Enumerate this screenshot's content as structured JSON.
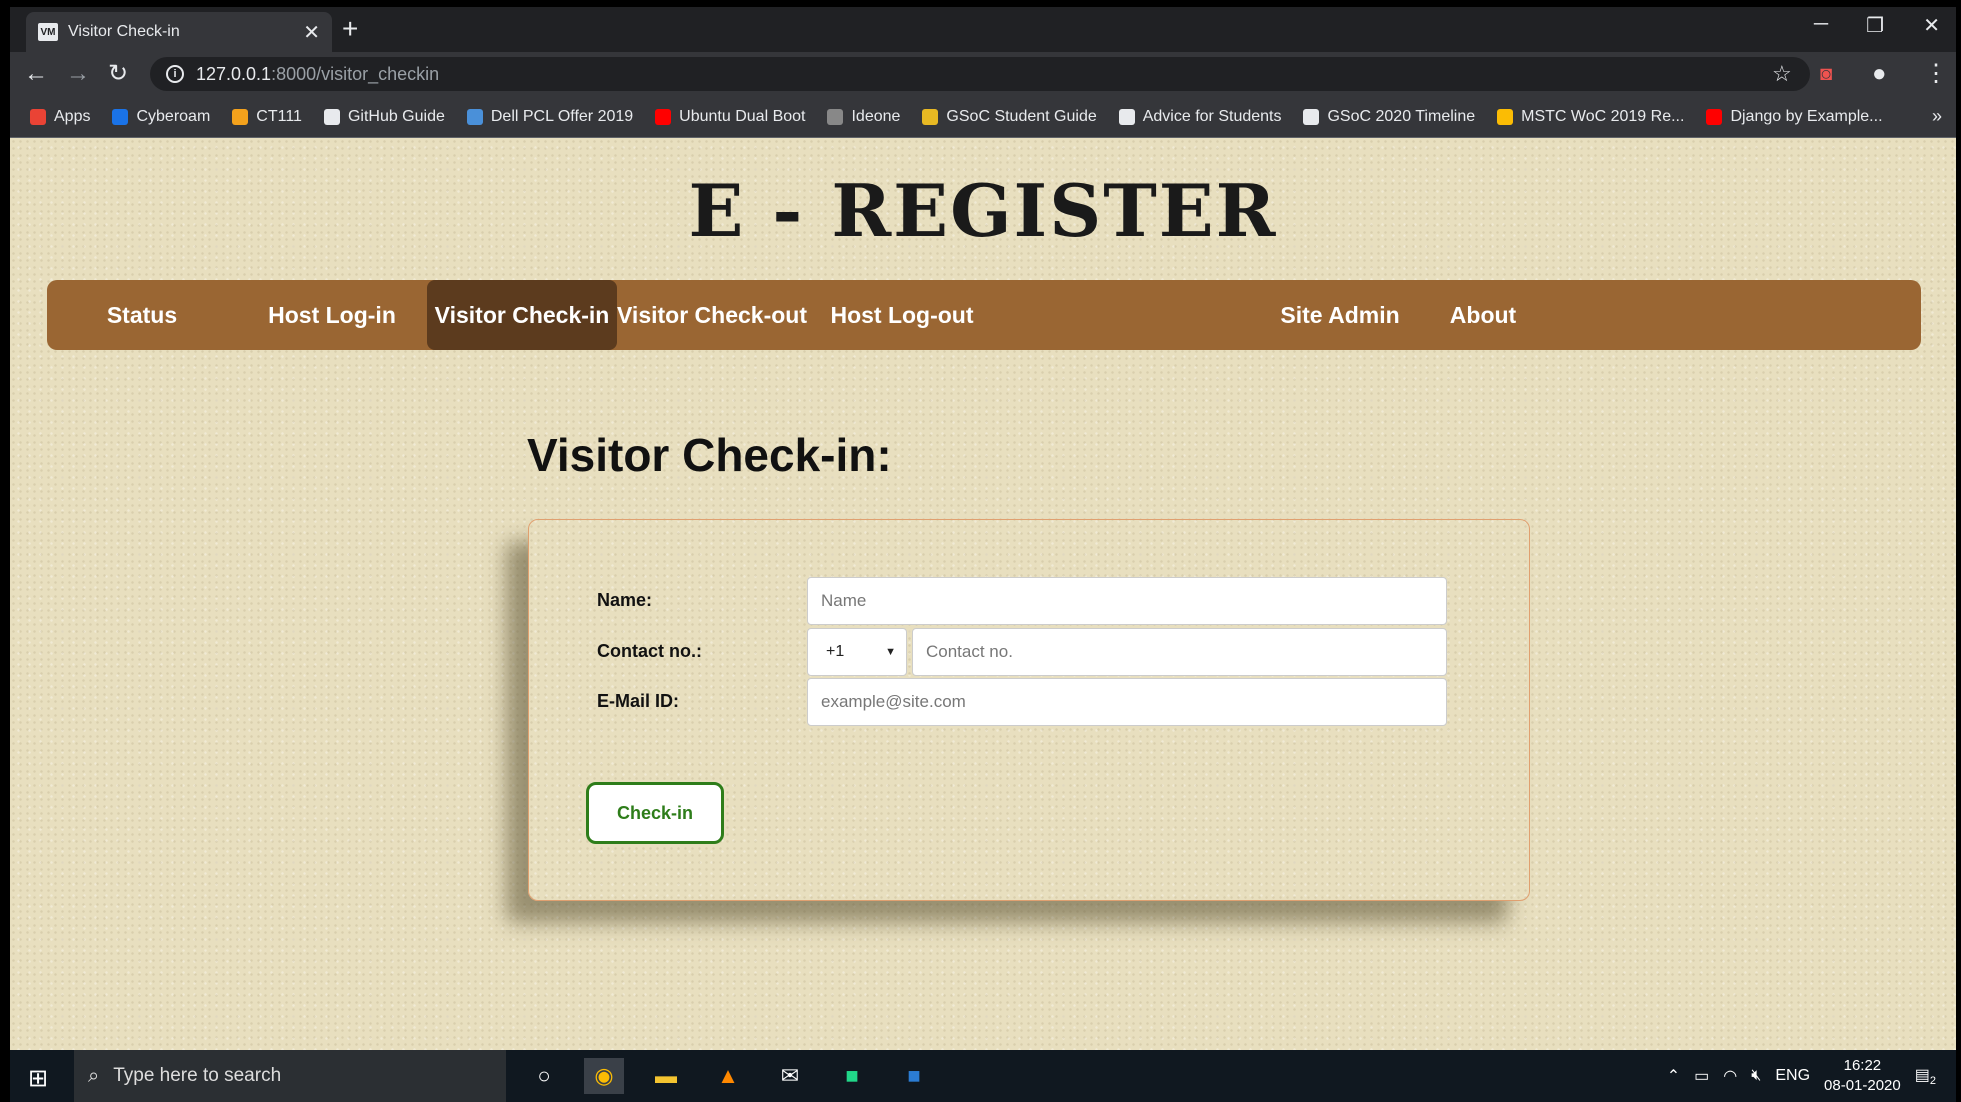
{
  "browser": {
    "tab_title": "Visitor Check-in",
    "tab_favicon": "VM",
    "url_host": "127.0.0.1",
    "url_path": ":8000/visitor_checkin",
    "bookmarks": [
      {
        "label": "Apps",
        "icon": "apps-grid-icon",
        "color": "#ea4335"
      },
      {
        "label": "Cyberoam",
        "icon": "cyberoam-icon",
        "color": "#1a73e8"
      },
      {
        "label": "CT111",
        "icon": "ct111-icon",
        "color": "#f4a21c"
      },
      {
        "label": "GitHub Guide",
        "icon": "github-icon",
        "color": "#e8eaed"
      },
      {
        "label": "Dell PCL Offer 2019",
        "icon": "dell-icon",
        "color": "#4a90d9"
      },
      {
        "label": "Ubuntu Dual Boot",
        "icon": "youtube-icon",
        "color": "#ff0000"
      },
      {
        "label": "Ideone",
        "icon": "ideone-icon",
        "color": "#888888"
      },
      {
        "label": "GSoC Student Guide",
        "icon": "gsoc-icon",
        "color": "#e8b923"
      },
      {
        "label": "Advice for Students",
        "icon": "code-icon",
        "color": "#e8eaed"
      },
      {
        "label": "GSoC 2020 Timeline",
        "icon": "code-icon",
        "color": "#e8eaed"
      },
      {
        "label": "MSTC WoC 2019 Re...",
        "icon": "drive-icon",
        "color": "#fbbc04"
      },
      {
        "label": "Django by Example...",
        "icon": "youtube-icon",
        "color": "#ff0000"
      }
    ]
  },
  "site": {
    "logo": "E - REGISTER",
    "menu": [
      {
        "label": "Status",
        "active": false
      },
      {
        "label": "Host Log-in",
        "active": false
      },
      {
        "label": "Visitor Check-in",
        "active": true
      },
      {
        "label": "Visitor Check-out",
        "active": false
      },
      {
        "label": "Host Log-out",
        "active": false
      },
      {
        "label": "Site Admin",
        "active": false
      },
      {
        "label": "About",
        "active": false
      }
    ]
  },
  "form": {
    "heading": "Visitor Check-in:",
    "name_label": "Name:",
    "name_placeholder": "Name",
    "contact_label": "Contact no.:",
    "country_code": "+1",
    "contact_placeholder": "Contact no.",
    "email_label": "E-Mail ID:",
    "email_placeholder": "example@site.com",
    "submit_label": "Check-in"
  },
  "taskbar": {
    "search_placeholder": "Type here to search",
    "lang": "ENG",
    "time": "16:22",
    "date": "08-01-2020",
    "notifications": "2"
  },
  "colors": {
    "menu_bg": "#9a6633",
    "menu_active": "#5c3b1e",
    "button_green": "#2e7d1a",
    "card_border": "#e0a070"
  }
}
